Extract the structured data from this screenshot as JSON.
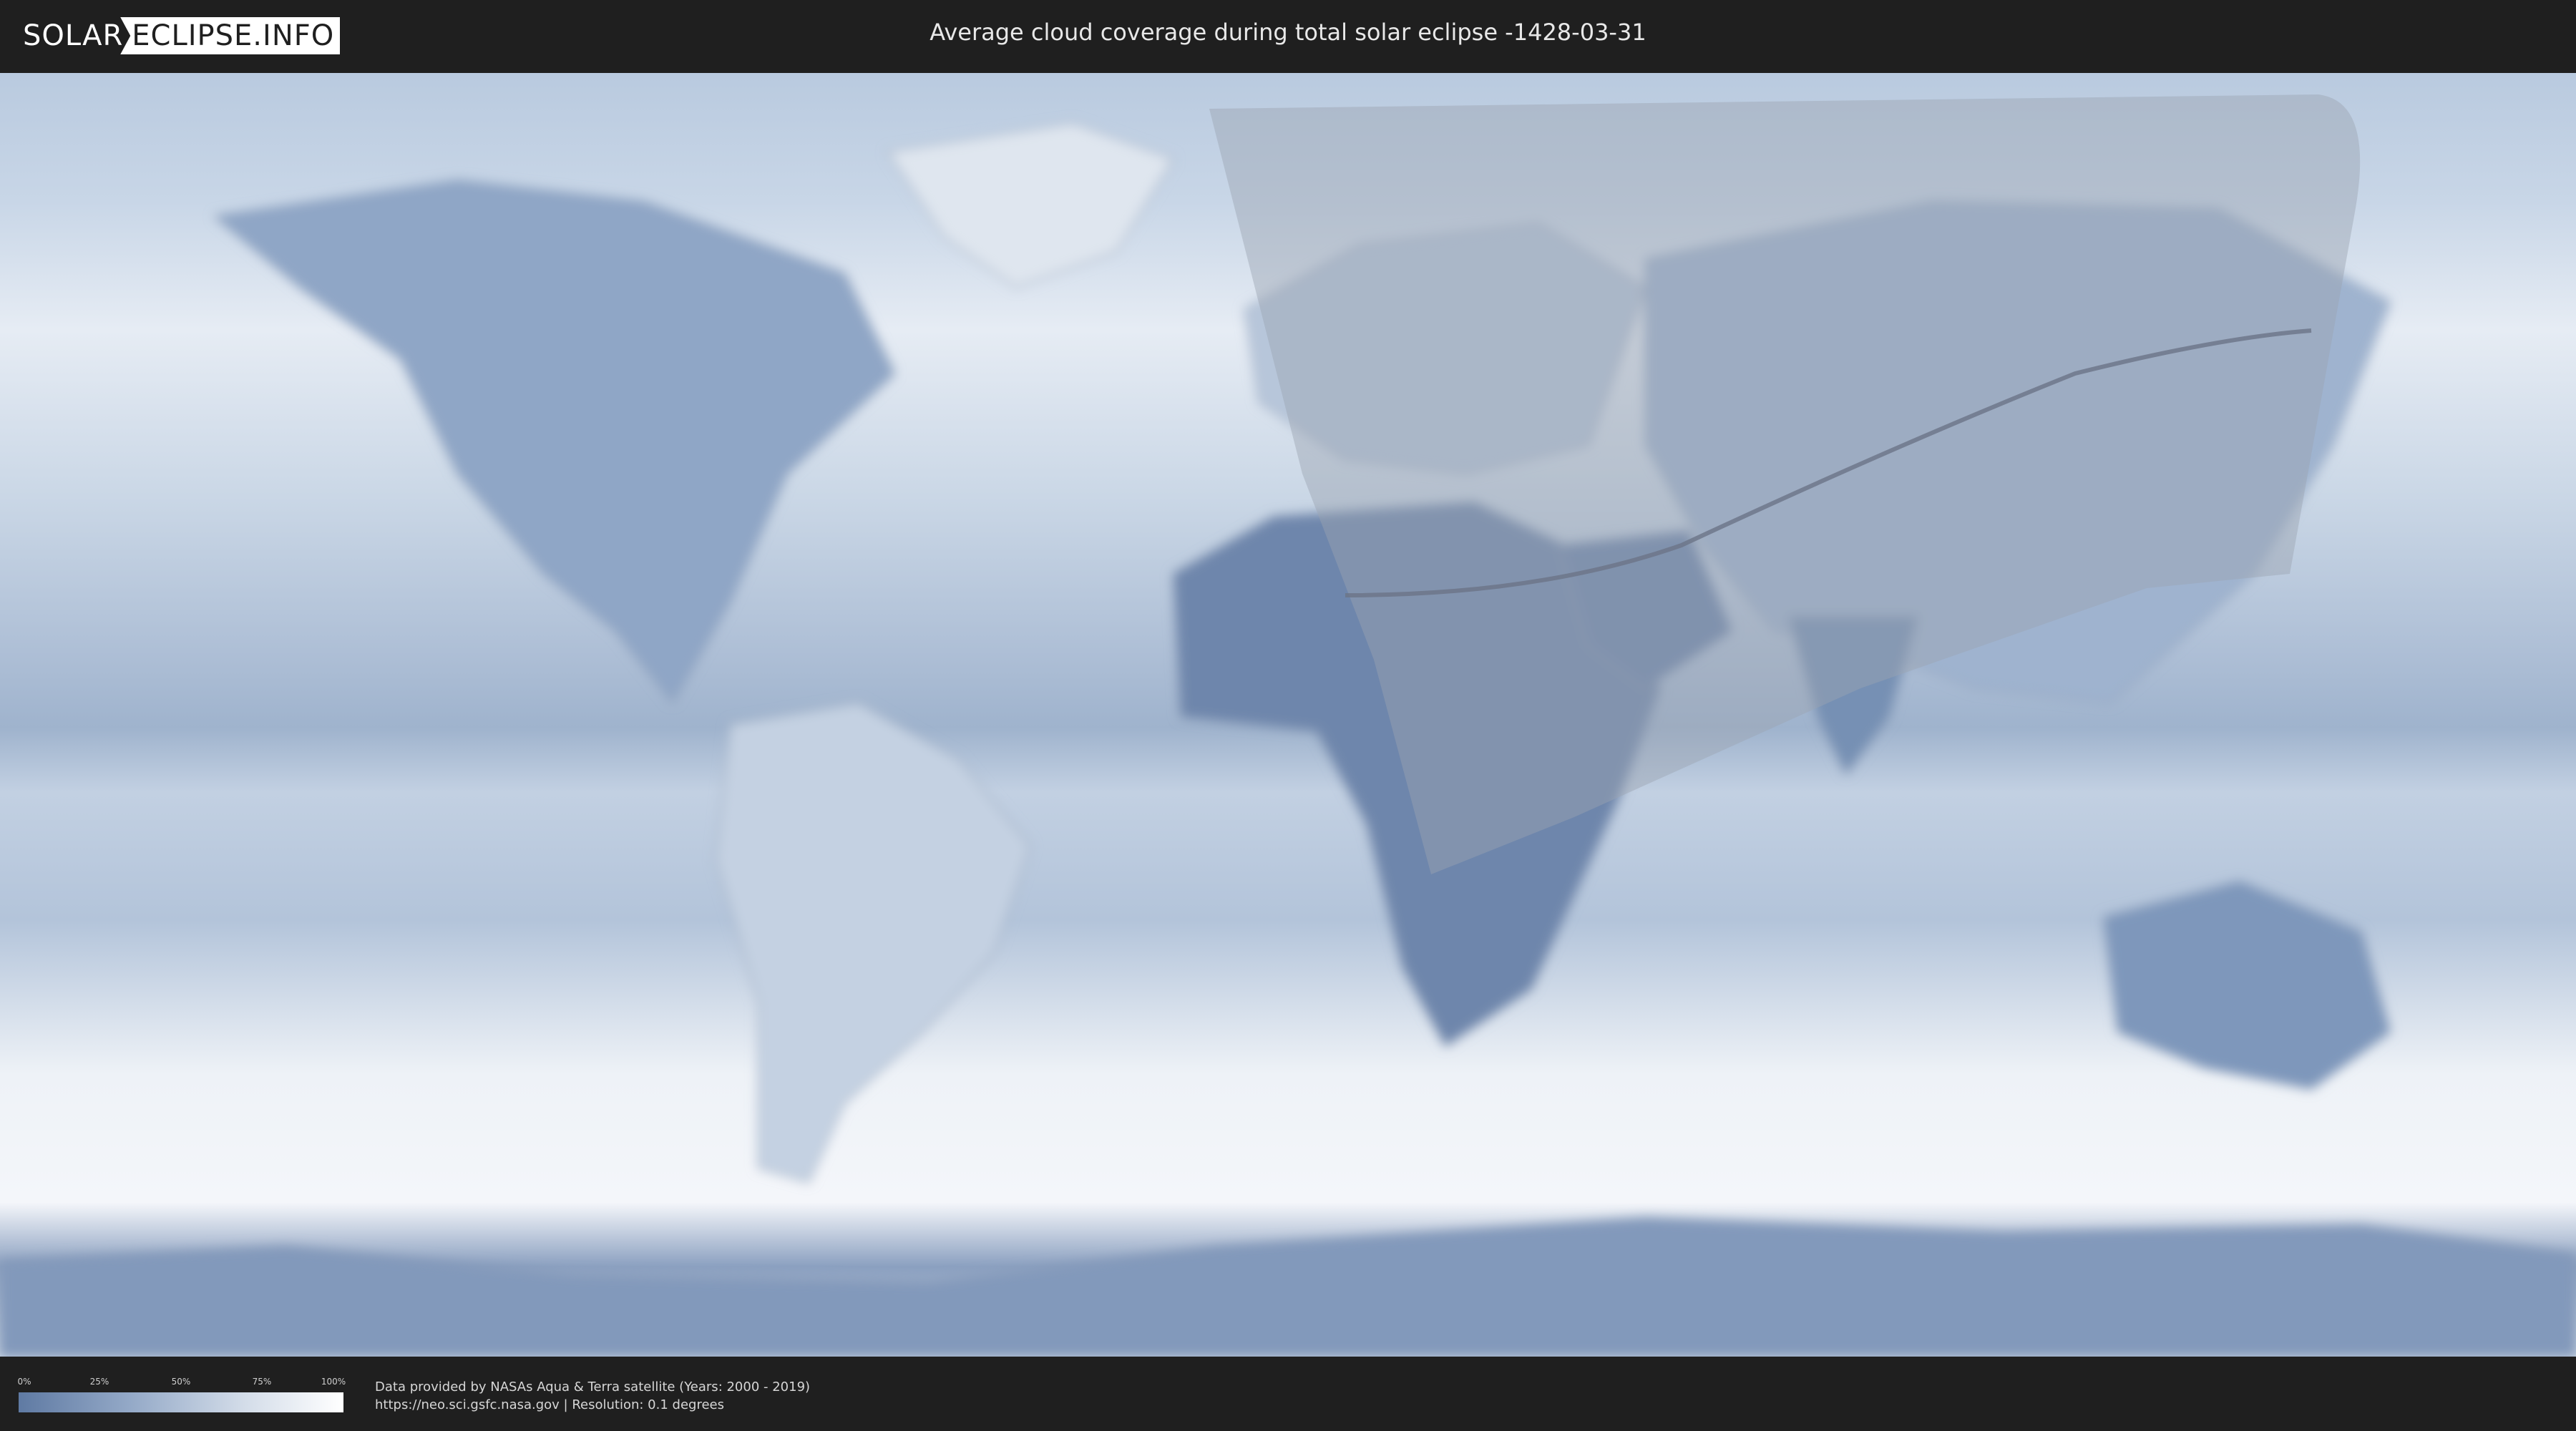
{
  "header": {
    "logo_part_a": "SOLAR",
    "logo_part_b": "ECLIPSE.INFO",
    "title": "Average cloud coverage during total solar eclipse -1428-03-31"
  },
  "map": {
    "shaded_region": "eclipse visibility area",
    "path_line": "path of totality"
  },
  "legend": {
    "ticks": [
      "0%",
      "25%",
      "50%",
      "75%",
      "100%"
    ],
    "colors": {
      "low": "#5f7aa3",
      "high": "#ffffff"
    }
  },
  "source": {
    "line1": "Data provided by NASAs Aqua & Terra satellite (Years: 2000 - 2019)",
    "line2": "https://neo.sci.gsfc.nasa.gov | Resolution: 0.1 degrees"
  }
}
